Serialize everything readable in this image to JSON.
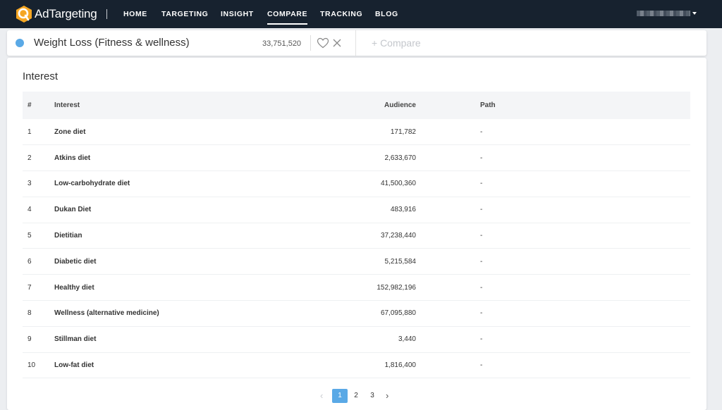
{
  "nav": {
    "brand": "AdTargeting",
    "links": [
      "HOME",
      "TARGETING",
      "INSIGHT",
      "COMPARE",
      "TRACKING",
      "BLOG"
    ],
    "active": "COMPARE",
    "brand_color": "#f5a623"
  },
  "compare": {
    "topic": "Weight Loss (Fitness & wellness)",
    "count": "33,751,520",
    "add_label": "+ Compare",
    "dot_color": "#5aa9e6"
  },
  "section": {
    "title": "Interest"
  },
  "table": {
    "headers": [
      "#",
      "Interest",
      "Audience",
      "Path"
    ],
    "rows": [
      {
        "num": "1",
        "interest": "Zone diet",
        "audience": "171,782",
        "path": "-"
      },
      {
        "num": "2",
        "interest": "Atkins diet",
        "audience": "2,633,670",
        "path": "-"
      },
      {
        "num": "3",
        "interest": "Low-carbohydrate diet",
        "audience": "41,500,360",
        "path": "-"
      },
      {
        "num": "4",
        "interest": "Dukan Diet",
        "audience": "483,916",
        "path": "-"
      },
      {
        "num": "5",
        "interest": "Dietitian",
        "audience": "37,238,440",
        "path": "-"
      },
      {
        "num": "6",
        "interest": "Diabetic diet",
        "audience": "5,215,584",
        "path": "-"
      },
      {
        "num": "7",
        "interest": "Healthy diet",
        "audience": "152,982,196",
        "path": "-"
      },
      {
        "num": "8",
        "interest": "Wellness (alternative medicine)",
        "audience": "67,095,880",
        "path": "-"
      },
      {
        "num": "9",
        "interest": "Stillman diet",
        "audience": "3,440",
        "path": "-"
      },
      {
        "num": "10",
        "interest": "Low-fat diet",
        "audience": "1,816,400",
        "path": "-"
      }
    ]
  },
  "pagination": {
    "prev": "‹",
    "pages": [
      "1",
      "2",
      "3"
    ],
    "current": "1",
    "next": "›",
    "accent": "#5aa9e6"
  }
}
